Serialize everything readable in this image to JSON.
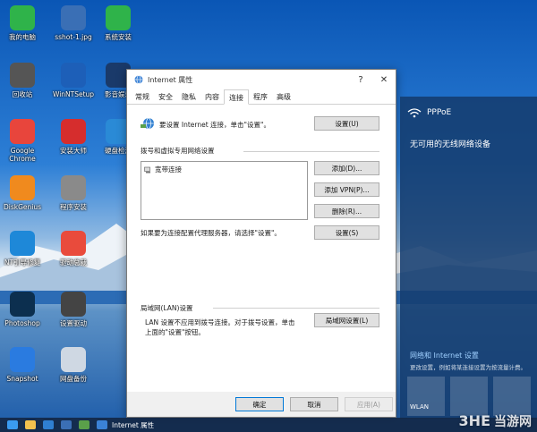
{
  "desktop": {
    "icons": [
      {
        "label": "我的电脑",
        "icon": "computer-icon",
        "color": "#2fb34a"
      },
      {
        "label": "sshot-1.jpg",
        "icon": "image-file-icon",
        "color": "#3a6fb5"
      },
      {
        "label": "系统安装",
        "icon": "download-icon",
        "color": "#2fb34a"
      },
      {
        "label": "回收站",
        "icon": "recycle-bin-icon",
        "color": "#555555"
      },
      {
        "label": "WinNTSetup",
        "icon": "setup-icon",
        "color": "#1d5fb8"
      },
      {
        "label": "影音娱乐",
        "icon": "media-icon",
        "color": "#1a3a6a"
      },
      {
        "label": "Google\nChrome",
        "icon": "chrome-icon",
        "color": "#e8453c"
      },
      {
        "label": "安装大师",
        "icon": "install-master-icon",
        "color": "#d62d2d"
      },
      {
        "label": "硬盘检测",
        "icon": "disk-check-icon",
        "color": "#2a8ad6"
      },
      {
        "label": "DiskGenius",
        "icon": "diskgenius-icon",
        "color": "#f08a1e"
      },
      {
        "label": "程序安装",
        "icon": "program-install-icon",
        "color": "#8a8a8a"
      },
      {
        "label": "NT引导修复",
        "icon": "boot-repair-icon",
        "color": "#1e88d8"
      },
      {
        "label": "驱动总裁",
        "icon": "driver-icon",
        "color": "#e94b3c"
      },
      {
        "label": "Photoshop",
        "icon": "photoshop-icon",
        "color": "#0c2f4f"
      },
      {
        "label": "设置驱动",
        "icon": "driver-settings-icon",
        "color": "#444444"
      },
      {
        "label": "Snapshot",
        "icon": "snapshot-icon",
        "color": "#2a7be0"
      },
      {
        "label": "网盘备份",
        "icon": "cloud-backup-icon",
        "color": "#cfd8e3"
      }
    ]
  },
  "dialog": {
    "title": "Internet 属性",
    "close": "✕",
    "minimize": "—",
    "maximize": "☐",
    "help": "?",
    "tabs": [
      "常规",
      "安全",
      "隐私",
      "内容",
      "连接",
      "程序",
      "高级"
    ],
    "active_tab": "连接",
    "setup_text": "要设置 Internet 连接，单击\"设置\"。",
    "setup_button": "设置(U)",
    "dialup_section": "拨号和虚拟专用网络设置",
    "connections": [
      "宽带连接"
    ],
    "add_button": "添加(D)...",
    "add_vpn_button": "添加 VPN(P)...",
    "delete_button": "删除(R)...",
    "proxy_text": "如果要为连接配置代理服务器，请选择\"设置\"。",
    "settings_button": "设置(S)",
    "lan_section": "局域网(LAN)设置",
    "lan_text_1": "LAN 设置不应用到拨号连接。对于拨号设置，单击",
    "lan_text_2": "上面的\"设置\"按钮。",
    "lan_button": "局域网设置(L)",
    "ok_button": "确定",
    "cancel_button": "取消",
    "apply_button": "应用(A)"
  },
  "flyout": {
    "connection_name": "PPPoE",
    "no_wireless": "无可用的无线网络设备",
    "settings_link": "网络和 Internet 设置",
    "settings_sub": "更改设置，例如将某连接设置为按流量计费。",
    "tile_1": "WLAN"
  },
  "taskbar": {
    "task_label": "Internet 属性"
  },
  "watermark": {
    "brand": "3HE",
    "text": "当游网"
  }
}
